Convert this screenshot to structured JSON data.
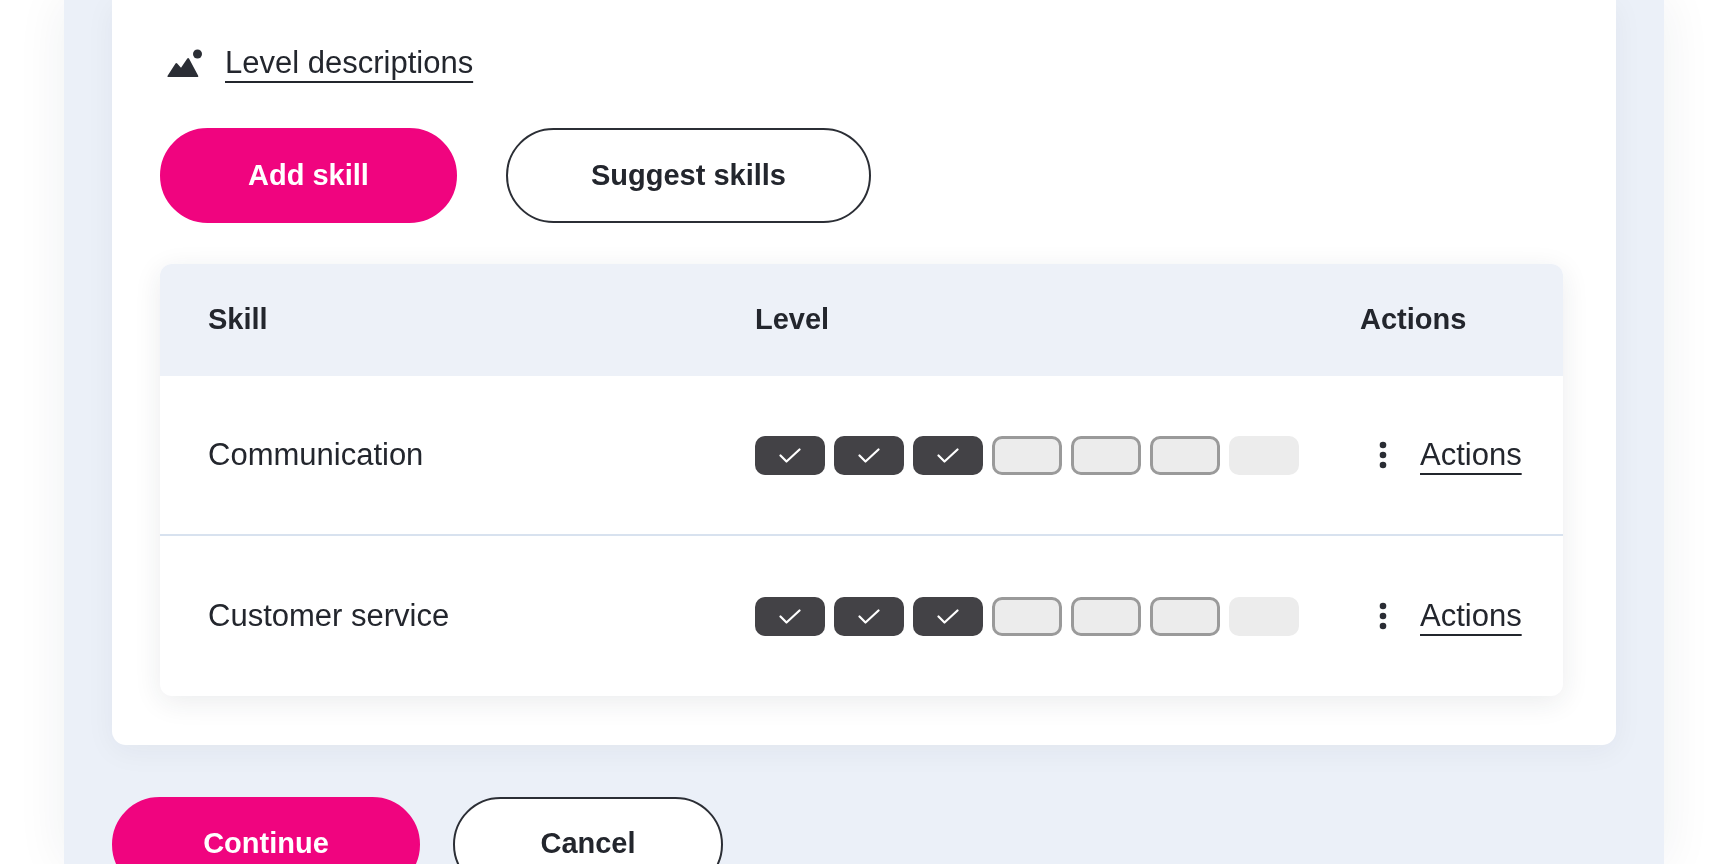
{
  "level_descriptions_link": {
    "label": "Level descriptions"
  },
  "skill_buttons": [
    {
      "label": "Add skill",
      "kind": "primary"
    },
    {
      "label": "Suggest skills",
      "kind": "secondary"
    }
  ],
  "table": {
    "columns": [
      "Skill",
      "Level",
      "Actions"
    ],
    "rows": [
      {
        "skill": "Communication",
        "segments": [
          {
            "checked": true,
            "disabled": false
          },
          {
            "checked": true,
            "disabled": false
          },
          {
            "checked": true,
            "disabled": false
          },
          {
            "checked": false,
            "disabled": false
          },
          {
            "checked": false,
            "disabled": false
          },
          {
            "checked": false,
            "disabled": false
          },
          {
            "checked": false,
            "disabled": true
          }
        ],
        "action": "Actions"
      },
      {
        "skill": "Customer service",
        "segments": [
          {
            "checked": true,
            "disabled": false
          },
          {
            "checked": true,
            "disabled": false
          },
          {
            "checked": true,
            "disabled": false
          },
          {
            "checked": false,
            "disabled": false
          },
          {
            "checked": false,
            "disabled": false
          },
          {
            "checked": false,
            "disabled": false
          },
          {
            "checked": false,
            "disabled": true
          }
        ],
        "action": "Actions"
      }
    ]
  },
  "footer_buttons": [
    {
      "label": "Continue",
      "kind": "primary"
    },
    {
      "label": "Cancel",
      "kind": "secondary"
    }
  ]
}
